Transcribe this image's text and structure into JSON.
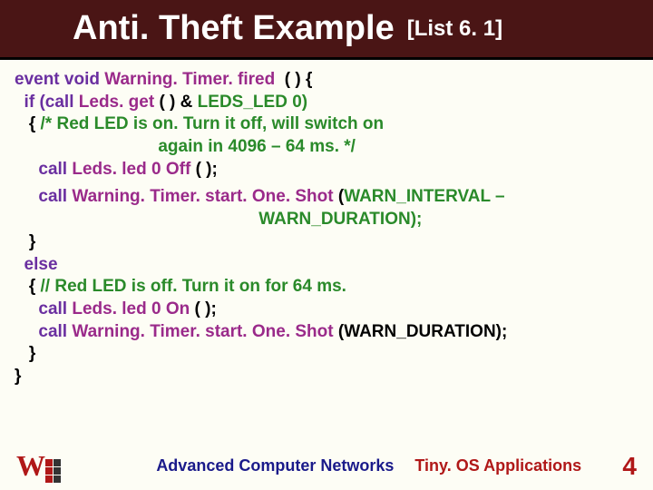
{
  "header": {
    "title_main": "Anti. Theft Example",
    "title_sub": "[List 6. 1]"
  },
  "code": {
    "l1_a": "event void ",
    "l1_b": "Warning. Timer. fired ",
    "l1_c": " ( ) {",
    "l2_a": "  if ",
    "l2_b": "(call ",
    "l2_c": "Leds. get ",
    "l2_d": "( ) & ",
    "l2_e": "LEDS_LED 0)",
    "l3_a": "   { ",
    "l3_b": "/* Red LED is on. Turn it off, will switch on",
    "l4": "                              again in 4096 – 64 ms. */",
    "l5_a": "     call ",
    "l5_b": "Leds. led 0 Off ",
    "l5_c": "( );",
    "l6_a": "     call ",
    "l6_b": "Warning. Timer. start. One. Shot ",
    "l6_c": "(",
    "l6_d": "WARN_INTERVAL –",
    "l7": "                                                   WARN_DURATION);",
    "l8": "   }",
    "l9": "  else",
    "l10_a": "   { ",
    "l10_b": "// Red LED is off. Turn it on for 64 ms.",
    "l11_a": "     call ",
    "l11_b": "Leds. led 0 On ",
    "l11_c": "( );",
    "l12_a": "     call ",
    "l12_b": "Warning. Timer. start. One. Shot ",
    "l12_c": "(WARN_DURATION);",
    "l13": "   }",
    "l14": "}"
  },
  "footer": {
    "logo_letter": "W",
    "course": "Advanced Computer Networks",
    "topic": "Tiny. OS Applications",
    "page": "4"
  }
}
